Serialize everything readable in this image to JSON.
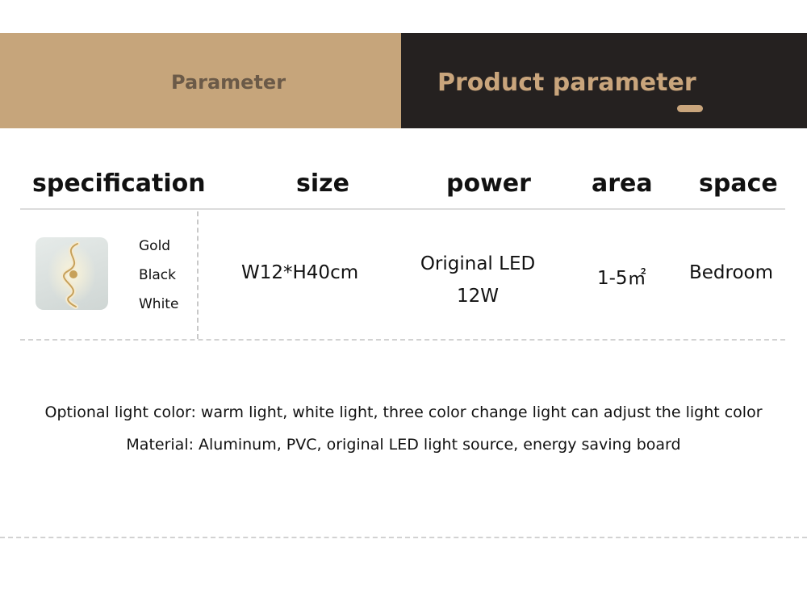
{
  "banner": {
    "left_label": "Parameter",
    "right_label": "Product parameter"
  },
  "table": {
    "headers": [
      "specification",
      "size",
      "power",
      "area",
      "space"
    ],
    "row": {
      "colors": [
        "Gold",
        "Black",
        "White"
      ],
      "size": "W12*H40cm",
      "power_line1": "Original LED",
      "power_line2": "12W",
      "area": "1-5㎡",
      "space": "Bedroom"
    }
  },
  "notes": {
    "light_color": "Optional light color: warm light, white light, three color change light can adjust the light color",
    "material": "Material: Aluminum, PVC, original LED light source, energy saving board"
  },
  "colors": {
    "banner_gold": "#c6a57b",
    "banner_dark": "#252120",
    "title_gold": "#c9a57c"
  }
}
